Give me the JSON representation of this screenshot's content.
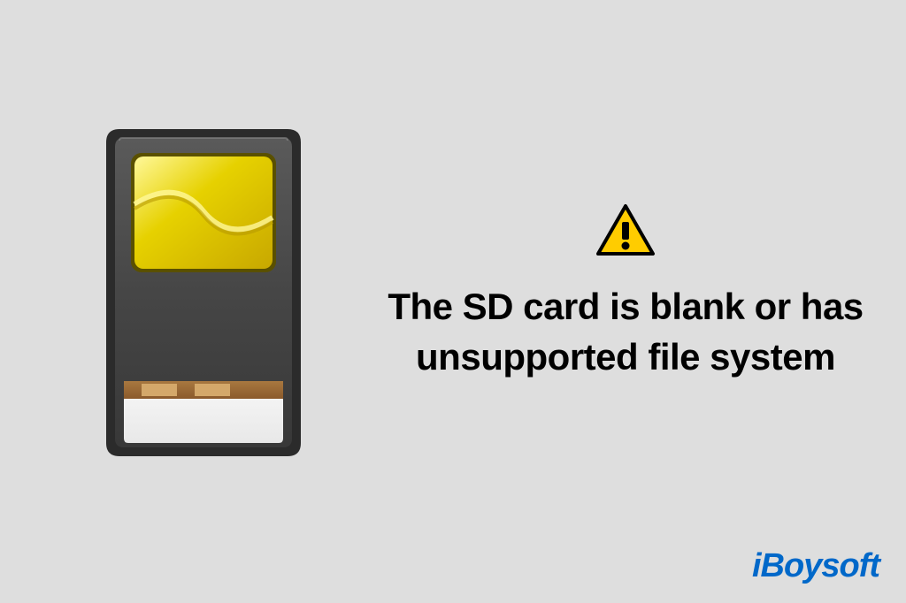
{
  "message": {
    "text": "The SD card is blank or has unsupported file system"
  },
  "logo": {
    "text": "iBoysoft"
  },
  "icons": {
    "warning": "warning-triangle",
    "sdcard": "sd-card"
  },
  "colors": {
    "background": "#dedede",
    "text": "#000000",
    "logo": "#0068c9",
    "warning_fill": "#ffcc00",
    "card_body": "#464646",
    "card_gold": "#e6d100"
  }
}
